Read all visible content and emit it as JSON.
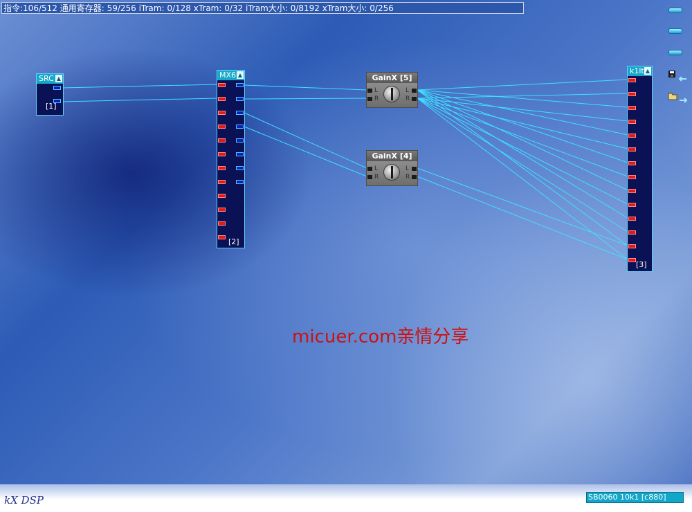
{
  "status_bar": {
    "text": "指令:106/512 通用寄存器: 59/256 iTram: 0/128 xTram: 0/32 iTram大小: 0/8192 xTram大小: 0/256"
  },
  "modules": {
    "src": {
      "title": "SRC",
      "number": "[1]"
    },
    "mx6": {
      "title": "MX6",
      "number": "[2]"
    },
    "k1lt": {
      "title": "k1lt",
      "number": "[3]"
    },
    "gain5": {
      "title": "GainX [5]"
    },
    "gain4": {
      "title": "GainX [4]"
    }
  },
  "gain_labels": {
    "left": "L",
    "right": "R"
  },
  "module_arrow": "▲",
  "sidebar": {
    "icons": [
      "bar-button-icon",
      "bar-button-icon",
      "bar-button-icon",
      "save-arrow-icon",
      "open-arrow-icon"
    ]
  },
  "watermark": "micuer.com亲情分享",
  "footer": {
    "logo": "kX DSP",
    "device": "SB0060 10k1 [c880]"
  },
  "colors": {
    "wire": "#3fe0ff",
    "module_title": "#17a7c8",
    "port_red": "#e31a1a",
    "port_blue": "#0b1fb8"
  }
}
